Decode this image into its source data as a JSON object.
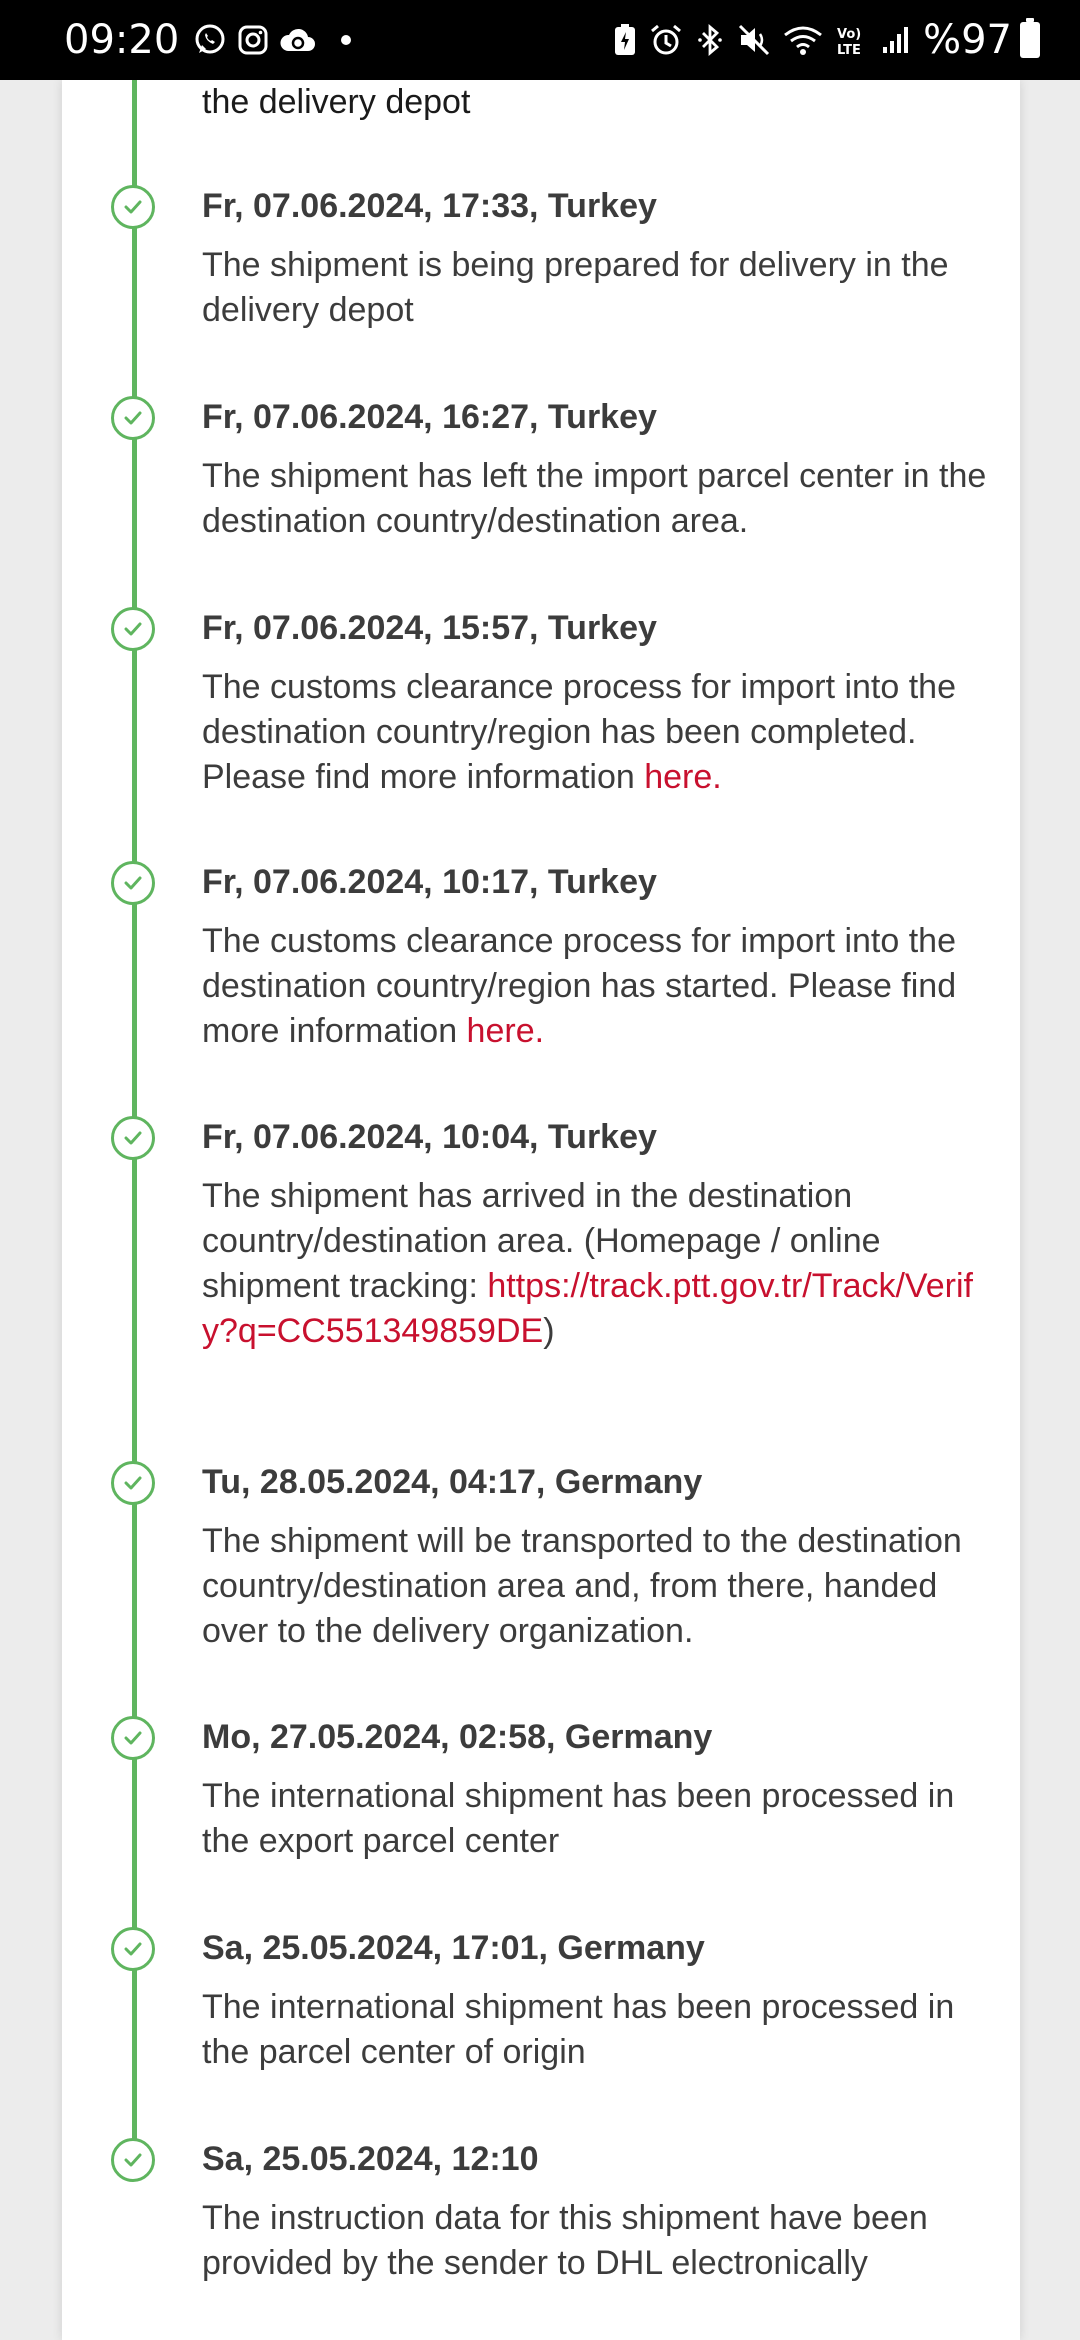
{
  "status_bar": {
    "time": "09:20",
    "battery": "%97",
    "left_icons": [
      "whatsapp-icon",
      "instagram-icon",
      "cloud-sync-icon"
    ],
    "right_icons": [
      "battery-saver-icon",
      "alarm-icon",
      "bluetooth-icon",
      "mute-icon",
      "wifi-icon",
      "volte-icon",
      "signal-icon"
    ]
  },
  "timeline": {
    "leading_text": "the delivery depot",
    "accent_color": "#5fb55f",
    "link_color": "#c8102e",
    "events": [
      {
        "title": "Fr, 07.06.2024, 17:33, Turkey",
        "desc": "The shipment is being prepared for delivery in the delivery depot"
      },
      {
        "title": "Fr, 07.06.2024, 16:27, Turkey",
        "desc": "The shipment has left the import parcel center in the destination country/destination area."
      },
      {
        "title": "Fr, 07.06.2024, 15:57, Turkey",
        "desc": "The customs clearance process for import into the destination country/region has been completed. Please find more information ",
        "link": "here."
      },
      {
        "title": "Fr, 07.06.2024, 10:17, Turkey",
        "desc": "The customs clearance process for import into the destination country/region has started. Please find more information ",
        "link": "here."
      },
      {
        "title": "Fr, 07.06.2024, 10:04, Turkey",
        "desc": "The shipment has arrived in the destination country/destination area. (Homepage / online shipment tracking: ",
        "link": "https://track.ptt.gov.tr/Track/Verify?q=CC551349859DE",
        "desc_after": ")"
      },
      {
        "title": "Tu, 28.05.2024, 04:17, Germany",
        "desc": "The shipment will be transported to the destination country/destination area and, from there, handed over to the delivery organization."
      },
      {
        "title": "Mo, 27.05.2024, 02:58, Germany",
        "desc": "The international shipment has been processed in the export parcel center"
      },
      {
        "title": "Sa, 25.05.2024, 17:01, Germany",
        "desc": "The international shipment has been processed in the parcel center of origin"
      },
      {
        "title": "Sa, 25.05.2024, 12:10",
        "desc": "The instruction data for this shipment have been provided by the sender to DHL electronically"
      }
    ]
  }
}
